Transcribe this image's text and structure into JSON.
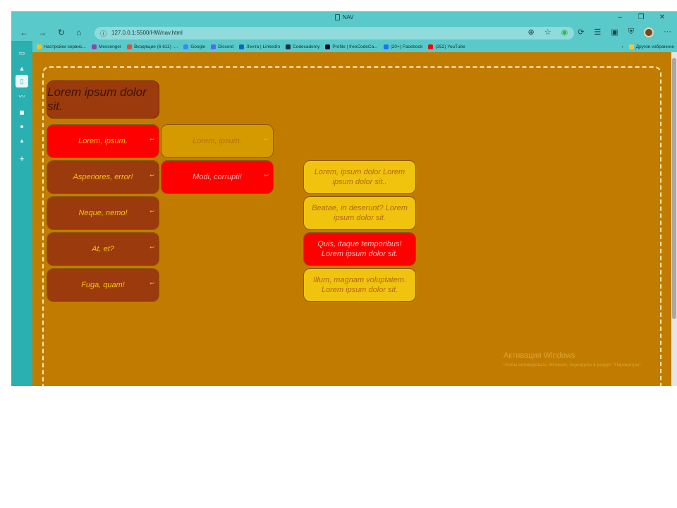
{
  "window": {
    "title": "NAV",
    "min": "–",
    "restore": "❐",
    "close": "✕"
  },
  "nav": {
    "back": "←",
    "forward": "→",
    "reload": "↻",
    "home": "⌂",
    "url": "127.0.0.1:5500/HW/nav.html",
    "menu": "···"
  },
  "bookmarks": [
    {
      "label": "Настройки сервис...",
      "color": "#f1c40f"
    },
    {
      "label": "Messenger",
      "color": "#8e44ad"
    },
    {
      "label": "Входящие (6 611) -...",
      "color": "#e74c3c"
    },
    {
      "label": "Google",
      "color": "#4285f4"
    },
    {
      "label": "Discord",
      "color": "#5865f2"
    },
    {
      "label": "Лента | LinkedIn",
      "color": "#0a66c2"
    },
    {
      "label": "Codecademy",
      "color": "#1f2d3d"
    },
    {
      "label": "Profile | freeCodeCa...",
      "color": "#0a0a23"
    },
    {
      "label": "(20+) Facebook",
      "color": "#1877f2"
    },
    {
      "label": "(352) YouTube",
      "color": "#ff0000"
    }
  ],
  "bookmarks_other": "Другое избранное",
  "page": {
    "heading": "Lorem ipsum dolor sit.",
    "col1": [
      "Lorem, ipsum.",
      "Asperiores, error!",
      "Neque, nemo!",
      "At, et?",
      "Fuga, quam!"
    ],
    "col2": [
      "Lorem, ipsum.",
      "Modi, corrupti!"
    ],
    "col3": [
      "Lorem, ipsum dolor Lorem ipsum dolor sit..",
      "Beatae, in deserunt? Lorem ipsum dolor sit.",
      "Quis, itaque temporibus! Lorem ipsum dolor sit.",
      "Illum, magnam voluptatem. Lorem ipsum dolor sit."
    ],
    "arrow": "↩"
  },
  "watermark": {
    "title": "Активация Windows",
    "sub": "Чтобы активировать Windows, перейдите в раздел \"Параметры\"."
  }
}
